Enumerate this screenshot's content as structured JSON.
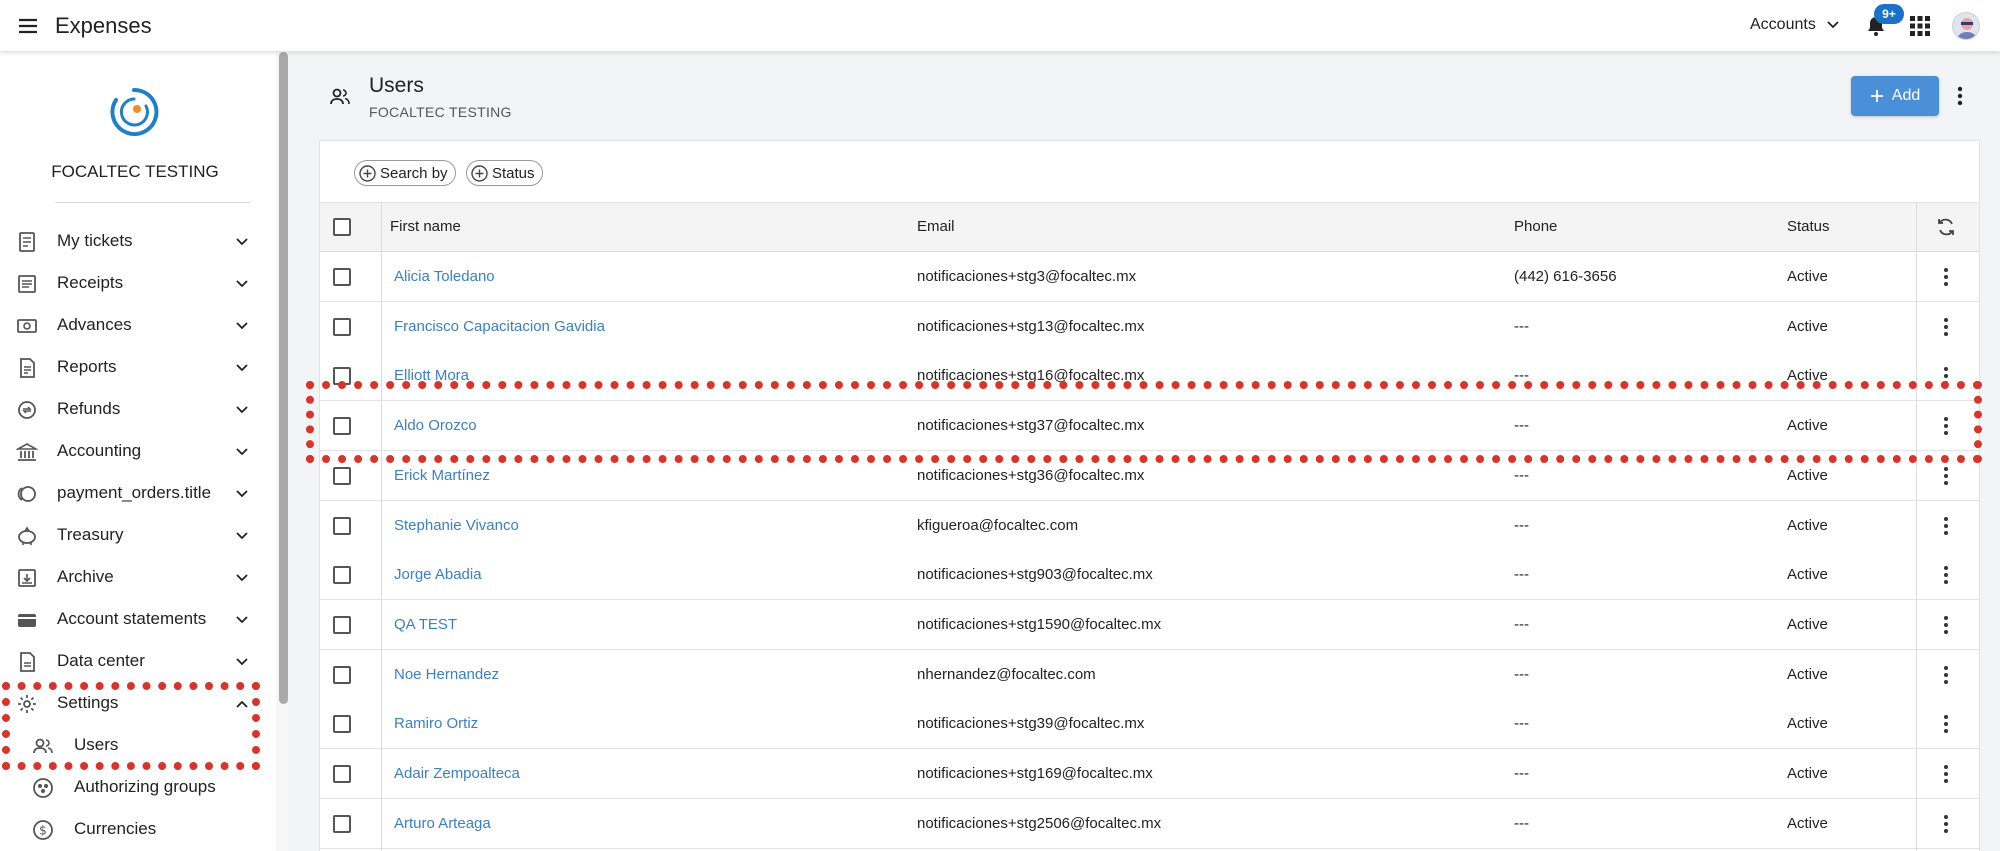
{
  "app": {
    "title": "Expenses"
  },
  "header": {
    "accounts_label": "Accounts",
    "notifications_badge": "9+"
  },
  "sidebar": {
    "org_name": "FOCALTEC TESTING",
    "items": [
      {
        "label": "My tickets",
        "icon": "ticket-icon"
      },
      {
        "label": "Receipts",
        "icon": "receipt-icon"
      },
      {
        "label": "Advances",
        "icon": "advance-icon"
      },
      {
        "label": "Reports",
        "icon": "report-icon"
      },
      {
        "label": "Refunds",
        "icon": "refund-icon"
      },
      {
        "label": "Accounting",
        "icon": "bank-icon"
      },
      {
        "label": "payment_orders.title",
        "icon": "coins-icon"
      },
      {
        "label": "Treasury",
        "icon": "piggy-bank-icon"
      },
      {
        "label": "Archive",
        "icon": "archive-icon"
      },
      {
        "label": "Account statements",
        "icon": "wallet-icon"
      },
      {
        "label": "Data center",
        "icon": "data-center-icon"
      },
      {
        "label": "Settings",
        "icon": "gear-icon",
        "expanded": true
      }
    ],
    "sub_items": [
      {
        "label": "Users",
        "icon": "users-icon"
      },
      {
        "label": "Authorizing groups",
        "icon": "group-icon"
      },
      {
        "label": "Currencies",
        "icon": "currency-icon"
      }
    ]
  },
  "page": {
    "title": "Users",
    "subtitle": "FOCALTEC TESTING",
    "add_label": "Add"
  },
  "filters": {
    "search_by": "Search by",
    "status": "Status"
  },
  "table": {
    "headers": {
      "first_name": "First name",
      "email": "Email",
      "phone": "Phone",
      "status": "Status"
    },
    "rows": [
      {
        "name": "Alicia Toledano",
        "email": "notificaciones+stg3@focaltec.mx",
        "phone": "(442) 616-3656",
        "status": "Active"
      },
      {
        "name": "Francisco Capacitacion Gavidia",
        "email": "notificaciones+stg13@focaltec.mx",
        "phone": "---",
        "status": "Active"
      },
      {
        "name": "Elliott Mora",
        "email": "notificaciones+stg16@focaltec.mx",
        "phone": "---",
        "status": "Active"
      },
      {
        "name": "Aldo Orozco",
        "email": "notificaciones+stg37@focaltec.mx",
        "phone": "---",
        "status": "Active"
      },
      {
        "name": "Erick Martínez",
        "email": "notificaciones+stg36@focaltec.mx",
        "phone": "---",
        "status": "Active"
      },
      {
        "name": "Stephanie Vivanco",
        "email": "kfigueroa@focaltec.com",
        "phone": "---",
        "status": "Active"
      },
      {
        "name": "Jorge Abadia",
        "email": "notificaciones+stg903@focaltec.mx",
        "phone": "---",
        "status": "Active"
      },
      {
        "name": "QA TEST",
        "email": "notificaciones+stg1590@focaltec.mx",
        "phone": "---",
        "status": "Active"
      },
      {
        "name": "Noe Hernandez",
        "email": "nhernandez@focaltec.com",
        "phone": "---",
        "status": "Active"
      },
      {
        "name": "Ramiro Ortiz",
        "email": "notificaciones+stg39@focaltec.mx",
        "phone": "---",
        "status": "Active"
      },
      {
        "name": "Adair Zempoalteca",
        "email": "notificaciones+stg169@focaltec.mx",
        "phone": "---",
        "status": "Active"
      },
      {
        "name": "Arturo Arteaga",
        "email": "notificaciones+stg2506@focaltec.mx",
        "phone": "---",
        "status": "Active"
      }
    ]
  },
  "colors": {
    "accent": "#4a90d9",
    "link": "#3b7fc4",
    "highlight": "#d9332a",
    "badge": "#1a73c8"
  }
}
